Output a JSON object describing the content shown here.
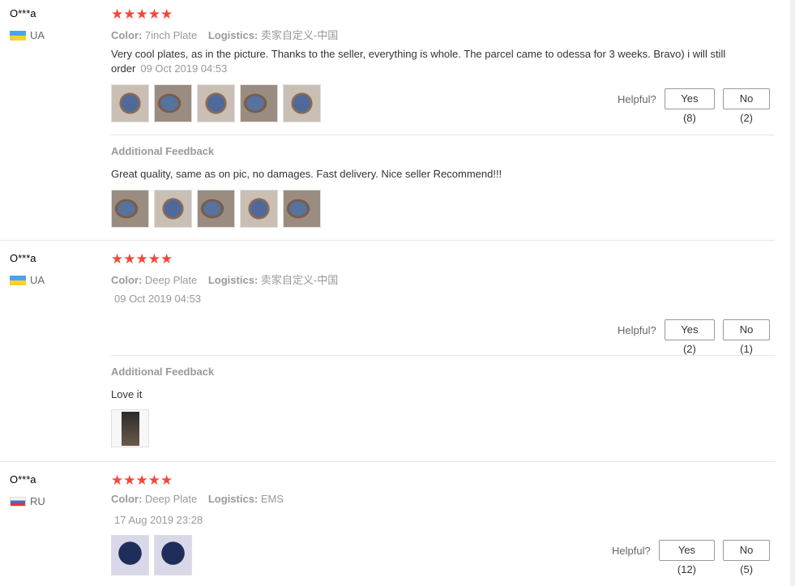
{
  "labels": {
    "color": "Color:",
    "logistics": "Logistics:",
    "additional_feedback": "Additional Feedback",
    "helpful": "Helpful?"
  },
  "reviews": [
    {
      "user": "O***a",
      "country": "UA",
      "rating_stars": "★★★★★",
      "color_value": "7inch Plate",
      "logistics_value": "卖家自定义-中国",
      "text": "Very cool plates, as in the picture. Thanks to the seller, everything is whole. The parcel came to odessa for 3 weeks. Bravo) i will still order",
      "date": "09 Oct 2019 04:53",
      "yes": "Yes (8)",
      "no": "No (2)",
      "additional_text": "Great quality, same as on pic, no damages. Fast delivery. Nice seller Recommend!!!"
    },
    {
      "user": "O***a",
      "country": "UA",
      "rating_stars": "★★★★★",
      "color_value": "Deep Plate",
      "logistics_value": "卖家自定义-中国",
      "date": "09 Oct 2019 04:53",
      "yes": "Yes (2)",
      "no": "No (1)",
      "additional_text": "Love it"
    },
    {
      "user": "O***a",
      "country": "RU",
      "rating_stars": "★★★★★",
      "color_value": "Deep Plate",
      "logistics_value": "EMS",
      "date": "17 Aug 2019 23:28",
      "yes": "Yes (12)",
      "no": "No (5)"
    }
  ]
}
